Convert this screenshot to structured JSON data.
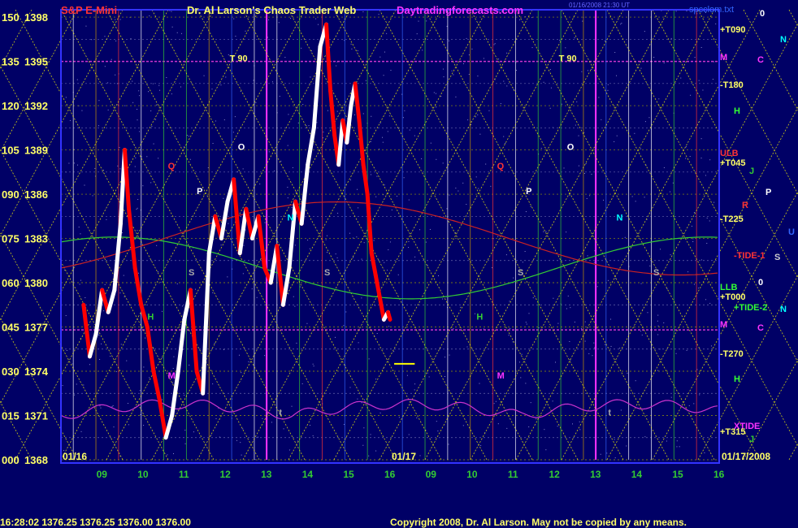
{
  "header": {
    "symbol": "S&P E-Mini",
    "site_title": "Dr. Al Larson's Chaos Trader Web",
    "site_url": "Daytradingforecasts.com",
    "stamp": "01/16/2008 21:30 UT",
    "file": "spcclom.txt"
  },
  "colors": {
    "background": "#000066",
    "plot_border": "#3333ff",
    "header_red": "#ff3333",
    "header_yellow": "#ffff66",
    "header_magenta": "#ff33ff",
    "price_up": "#ffffff",
    "price_down": "#ff0000",
    "magenta_line": "#cc33cc",
    "green_line": "#33cc33",
    "red_line": "#cc2222",
    "yellow_diag": "#ffff00"
  },
  "footer": {
    "quote": "16:28:02  1376.25  1376.25  1376.00  1376.00",
    "copyright": "Copyright 2008, Dr. Al Larson. May not be copied by any means."
  },
  "chart_data": {
    "type": "line",
    "title": "S&P E-Mini",
    "y_axis": {
      "ylim": [
        1368,
        1398.5
      ],
      "ticks": [
        {
          "pos": "000",
          "price": "1368"
        },
        {
          "pos": "015",
          "price": "1371"
        },
        {
          "pos": "030",
          "price": "1374"
        },
        {
          "pos": "045",
          "price": "1377"
        },
        {
          "pos": "060",
          "price": "1380"
        },
        {
          "pos": "075",
          "price": "1383"
        },
        {
          "pos": "090",
          "price": "1386"
        },
        {
          "pos": "105",
          "price": "1389"
        },
        {
          "pos": "120",
          "price": "1392"
        },
        {
          "pos": "135",
          "price": "1395"
        },
        {
          "pos": "150",
          "price": "1398"
        }
      ]
    },
    "x_axis": {
      "day_labels": [
        "01/16",
        "01/17"
      ],
      "hour_ticks": [
        "09",
        "10",
        "11",
        "12",
        "13",
        "14",
        "15",
        "16",
        "09",
        "10",
        "11",
        "12",
        "13",
        "14",
        "15",
        "16"
      ],
      "date_end": "01/17/2008"
    },
    "price_series": {
      "name": "E-Mini price (01/16)",
      "x_hours": [
        8.55,
        8.7,
        8.85,
        9.0,
        9.15,
        9.3,
        9.45,
        9.55,
        9.65,
        9.8,
        9.95,
        10.1,
        10.25,
        10.4,
        10.55,
        10.7,
        10.85,
        11.0,
        11.15,
        11.3,
        11.45,
        11.6,
        11.75,
        11.9,
        12.05,
        12.2,
        12.35,
        12.5,
        12.65,
        12.8,
        12.95,
        13.1,
        13.25,
        13.4,
        13.55,
        13.7,
        13.85,
        14.0,
        14.15,
        14.3,
        14.45,
        14.55,
        14.65,
        14.75,
        14.85,
        14.95,
        15.05,
        15.15,
        15.25,
        15.35,
        15.45,
        15.55,
        15.65,
        15.75,
        15.85,
        15.95,
        16.0
      ],
      "prices": [
        1378.5,
        1375.0,
        1376.5,
        1379.5,
        1378.0,
        1379.5,
        1384.0,
        1389.0,
        1385.0,
        1381.0,
        1378.5,
        1377.0,
        1374.0,
        1372.0,
        1369.5,
        1371.0,
        1374.0,
        1377.5,
        1379.5,
        1374.0,
        1372.5,
        1382.0,
        1384.5,
        1383.0,
        1385.5,
        1387.0,
        1382.0,
        1385.0,
        1383.0,
        1384.5,
        1381.0,
        1380.0,
        1382.5,
        1378.5,
        1381.0,
        1385.5,
        1384.0,
        1388.0,
        1390.5,
        1396.0,
        1397.5,
        1393.0,
        1390.0,
        1388.0,
        1391.0,
        1389.5,
        1392.0,
        1393.5,
        1391.0,
        1388.0,
        1386.0,
        1382.0,
        1380.5,
        1379.0,
        1377.5,
        1378.0,
        1377.5
      ]
    },
    "flux_labels": [
      "T 90",
      "T 90",
      "S",
      "S",
      "S",
      "S",
      "P",
      "P",
      "N",
      "N",
      "O",
      "O",
      "Q",
      "Q",
      "M",
      "M",
      "H",
      "H",
      "t",
      "t"
    ],
    "right_labels": [
      {
        "text": "0",
        "color": "#ffffff"
      },
      {
        "text": "+T090",
        "color": "#ffff66"
      },
      {
        "text": "N",
        "color": "#00ffff"
      },
      {
        "text": "M",
        "color": "#ff33ff"
      },
      {
        "text": "C",
        "color": "#ff33ff"
      },
      {
        "text": "-T180",
        "color": "#ffff66"
      },
      {
        "text": "H",
        "color": "#33ff33"
      },
      {
        "text": "ULB",
        "color": "#ff3333"
      },
      {
        "text": "+T045",
        "color": "#ffff66"
      },
      {
        "text": "J",
        "color": "#33cc33"
      },
      {
        "text": "P",
        "color": "#ffffff"
      },
      {
        "text": "R",
        "color": "#ff3333"
      },
      {
        "text": "-T225",
        "color": "#ffff66"
      },
      {
        "text": "U",
        "color": "#3366ff"
      },
      {
        "text": "-TIDE-1",
        "color": "#ff3333"
      },
      {
        "text": "S",
        "color": "#cccccc"
      },
      {
        "text": "0",
        "color": "#ffffff"
      },
      {
        "text": "LLB",
        "color": "#33ff33"
      },
      {
        "text": "+T000",
        "color": "#ffff66"
      },
      {
        "text": "+TIDE-2",
        "color": "#33ff33"
      },
      {
        "text": "N",
        "color": "#00ffff"
      },
      {
        "text": "M",
        "color": "#ff33ff"
      },
      {
        "text": "C",
        "color": "#ff33ff"
      },
      {
        "text": "-T270",
        "color": "#ffff66"
      },
      {
        "text": "H",
        "color": "#33ff33"
      },
      {
        "text": "XTIDE",
        "color": "#ff33ff"
      },
      {
        "text": "+T315",
        "color": "#ffff66"
      },
      {
        "text": "J",
        "color": "#33cc33"
      }
    ]
  }
}
